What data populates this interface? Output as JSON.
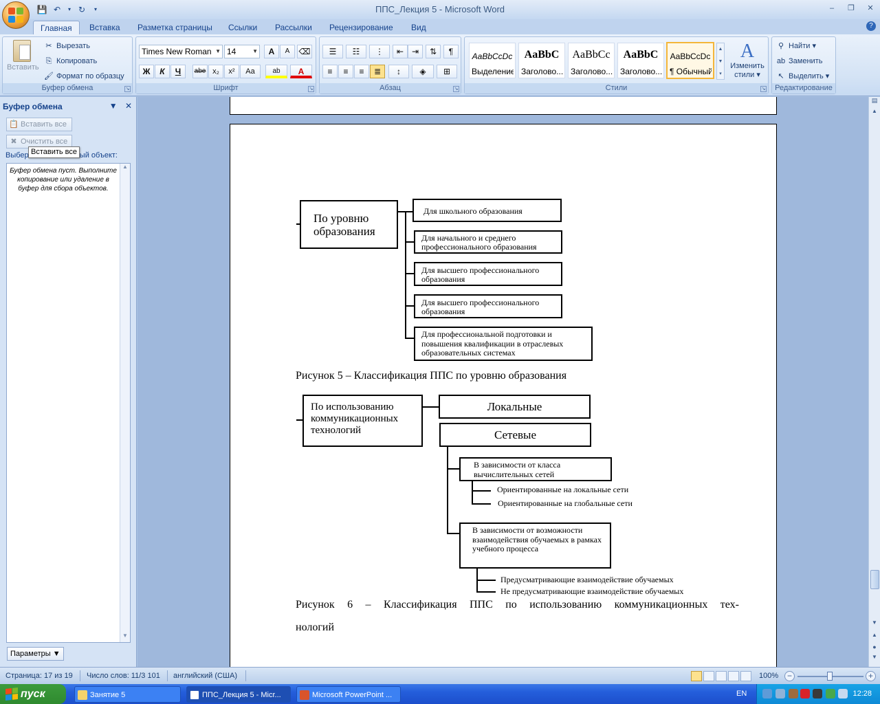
{
  "window": {
    "title": "ППС_Лекция 5 - Microsoft Word",
    "minimize": "‒",
    "maximize": "❐",
    "close": "✕",
    "doc_minimize": "‒",
    "doc_restore": "❐",
    "doc_close": "✕"
  },
  "qat": {
    "save": "💾",
    "undo": "↶",
    "redo": "↻",
    "more": "▾"
  },
  "tabs": [
    "Главная",
    "Вставка",
    "Разметка страницы",
    "Ссылки",
    "Рассылки",
    "Рецензирование",
    "Вид"
  ],
  "ribbon": {
    "clipboard": {
      "label": "Буфер обмена",
      "paste": "Вставить",
      "cut": "Вырезать",
      "copy": "Копировать",
      "format_painter": "Формат по образцу"
    },
    "font": {
      "label": "Шрифт",
      "font_name": "Times New Roman",
      "font_size": "14",
      "bold": "Ж",
      "italic": "К",
      "underline": "Ч",
      "strike": "abe",
      "subscript": "x₂",
      "superscript": "x²",
      "case": "Aa",
      "grow": "A",
      "shrink": "A",
      "highlight": "ab",
      "color": "A"
    },
    "paragraph": {
      "label": "Абзац"
    },
    "styles": {
      "label": "Стили",
      "items": [
        {
          "sample": "AaBbCcDc",
          "name": "Выделение"
        },
        {
          "sample": "AaBbC",
          "name": "Заголово..."
        },
        {
          "sample": "AaBbCc",
          "name": "Заголово..."
        },
        {
          "sample": "AaBbC",
          "name": "Заголово..."
        },
        {
          "sample": "AaBbCcDc",
          "name": "¶ Обычный"
        }
      ],
      "change": "Изменить",
      "change2": "стили"
    },
    "editing": {
      "label": "Редактирование",
      "find": "Найти",
      "replace": "Заменить",
      "select": "Выделить"
    }
  },
  "pane": {
    "title": "Буфер обмена",
    "paste_all": "Вставить все",
    "clear_all": "Очистить все",
    "prompt": "Выберите вставляемый объект:",
    "tooltip": "Вставить все",
    "empty": "Буфер обмена пуст. Выполните копирование или удаление в буфер для сбора объектов.",
    "options": "Параметры"
  },
  "figure5": {
    "root": "По уровню образования",
    "items": [
      "Для школьного образования",
      "Для начального и среднего профессионального образования",
      "Для высшего профессионального образования",
      "Для высшего профессионального образования",
      "Для профессиональной подготовки и повышения квалификации в отраслевых образовательных системах"
    ],
    "caption": "Рисунок 5 – Классификация ППС по уровню образования"
  },
  "figure6": {
    "root": "По использованию коммуникационных технологий",
    "local": "Локальные",
    "network": "Сетевые",
    "sub1": "В зависимости от класса вычислительных сетей",
    "sub1_items": [
      "Ориентированные на локальные сети",
      "Ориентированные на глобальные сети"
    ],
    "sub2": "В зависимости от возможности взаимодействия обучаемых в рамках учебного процесса",
    "sub2_items": [
      "Предусматривающие взаимодействие обучаемых",
      "Не предусматривающие взаимодействие обучаемых"
    ],
    "caption": "Рисунок 6 – Классификация ППС по использованию коммуникационных тех-",
    "caption2": "нологий"
  },
  "status": {
    "page": "Страница: 17 из 19",
    "words": "Число слов: 11/3 101",
    "lang": "английский (США)",
    "zoom": "100%"
  },
  "taskbar": {
    "start": "пуск",
    "tasks": [
      "Занятие 5",
      "ППС_Лекция 5 - Micr...",
      "Microsoft PowerPoint ..."
    ],
    "lang": "EN",
    "clock": "12:28"
  },
  "colors": {
    "ribbon_bg": "#d4e3f5",
    "accent": "#15428b",
    "taskbar": "#245edb",
    "start": "#2f8a2f"
  }
}
